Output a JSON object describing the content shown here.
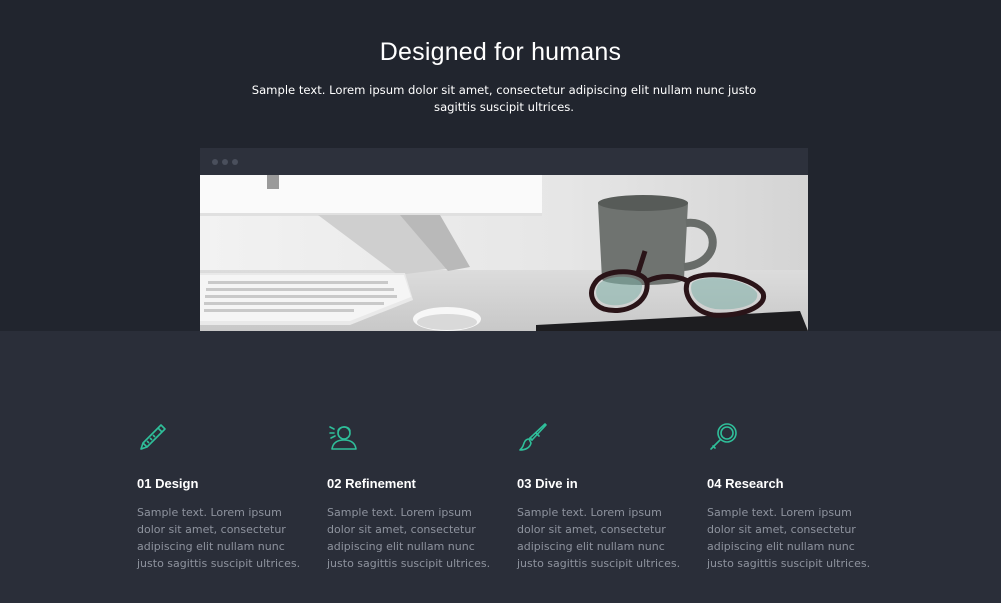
{
  "hero": {
    "title": "Designed for humans",
    "text": "Sample text. Lorem ipsum dolor sit amet, consectetur adipiscing elit nullam nunc justo sagittis suscipit ultrices."
  },
  "colors": {
    "background": "#21252e",
    "features_background": "#2a2e39",
    "accent": "#2fbf9a",
    "muted_text": "#8e939e"
  },
  "features": [
    {
      "icon": "pencil-icon",
      "title": "01 Design",
      "text": "Sample text. Lorem ipsum dolor sit amet, consectetur adipiscing elit nullam nunc justo sagittis suscipit ultrices."
    },
    {
      "icon": "person-icon",
      "title": "02 Refinement",
      "text": "Sample text. Lorem ipsum dolor sit amet, consectetur adipiscing elit nullam nunc justo sagittis suscipit ultrices."
    },
    {
      "icon": "brush-icon",
      "title": "03 Dive in",
      "text": "Sample text. Lorem ipsum dolor sit amet, consectetur adipiscing elit nullam nunc justo sagittis suscipit ultrices."
    },
    {
      "icon": "magnifier-icon",
      "title": "04 Research",
      "text": "Sample text. Lorem ipsum dolor sit amet, consectetur adipiscing elit nullam nunc justo sagittis suscipit ultrices."
    }
  ]
}
